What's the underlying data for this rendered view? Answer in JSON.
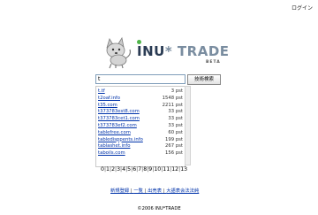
{
  "header": {
    "login_label": "ログイン"
  },
  "logo": {
    "brand_i": "I",
    "brand_nu": "NU",
    "brand_star": "*",
    "brand_trade": "TRADE",
    "badge": "BETA"
  },
  "search": {
    "value": "t",
    "button_label": "技術検索"
  },
  "results": [
    {
      "term": "t.tf",
      "count": "3 pst"
    },
    {
      "term": "t2oaf.info",
      "count": "1548 pst"
    },
    {
      "term": "t35.com",
      "count": "2211 pst"
    },
    {
      "term": "t373783est8.com",
      "count": "33 pst"
    },
    {
      "term": "t373783cet1.com",
      "count": "33 pst"
    },
    {
      "term": "t373783ef2.com",
      "count": "33 pst"
    },
    {
      "term": "tablefree.com",
      "count": "60 pst"
    },
    {
      "term": "tabledisppents.info",
      "count": "199 pst"
    },
    {
      "term": "tablashet.info",
      "count": "267 pst"
    },
    {
      "term": "taboils.com",
      "count": "156 pst"
    }
  ],
  "pager": {
    "pages": [
      "0",
      "1",
      "2",
      "3",
      "4",
      "5",
      "6",
      "7",
      "8",
      "9",
      "10",
      "11",
      "12",
      "13"
    ]
  },
  "nav": {
    "items": [
      "新規登録",
      "一覧",
      "出売表",
      "大語表会法法純"
    ]
  },
  "footer": {
    "copyright": "©2006 INU*TRADE"
  },
  "colors": {
    "brand_dark": "#2a3b53",
    "brand_light": "#7a8da0",
    "brand_green": "#4fb54a",
    "link": "#0033aa"
  }
}
